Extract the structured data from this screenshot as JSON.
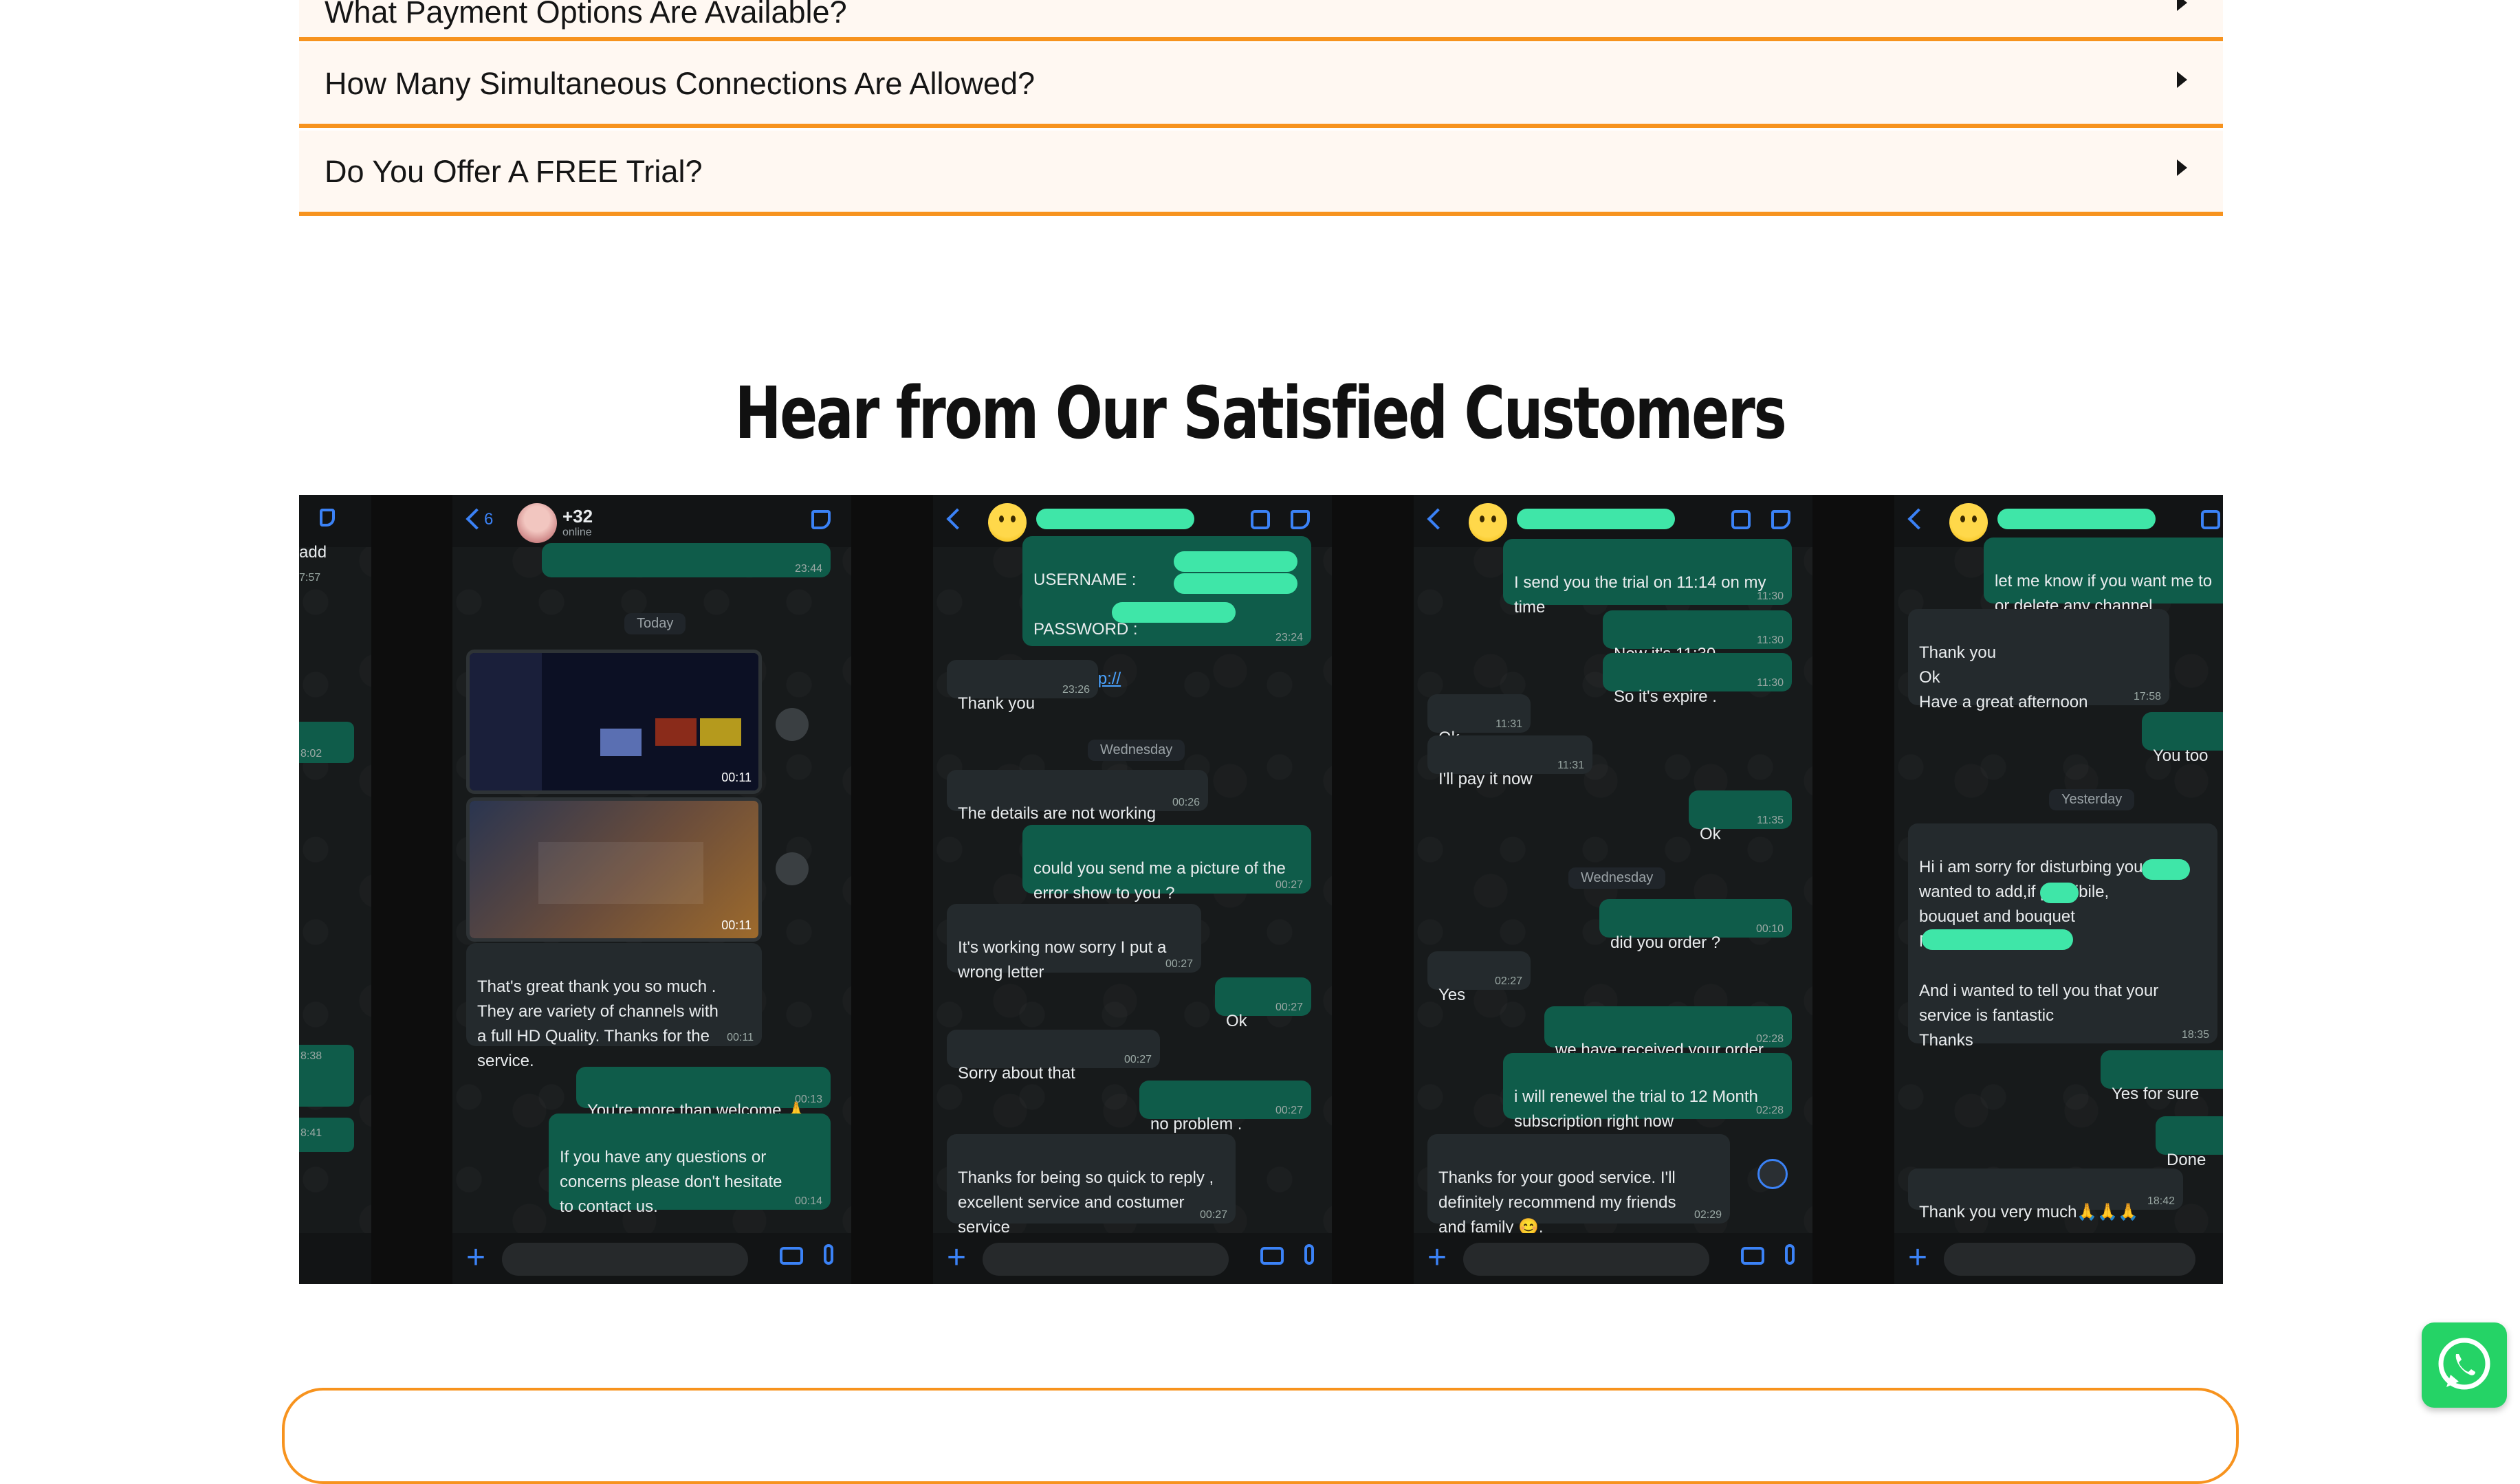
{
  "faq": {
    "items": [
      {
        "question": "What Payment Options Are Available?"
      },
      {
        "question": "How Many Simultaneous Connections Are Allowed?"
      },
      {
        "question": "Do You Offer A FREE Trial?"
      }
    ]
  },
  "testimonials": {
    "title": "Hear from Our Satisfied Customers",
    "screenshots": [
      {
        "header_number": "+32",
        "header_status": "online",
        "day": "Today",
        "messages": [
          {
            "text": "That's great thank you so much .\nThey are variety of channels with\na full HD Quality. Thanks for the\nservice.",
            "time": "00:11",
            "dir": "in"
          },
          {
            "text": "You're more than welcome 🙏",
            "time": "00:13",
            "dir": "out"
          },
          {
            "text": "If you have any questions or\nconcerns please don't hesitate\nto contact us.",
            "time": "00:14",
            "dir": "out"
          }
        ],
        "video_time_1": "00:11",
        "video_time_2": "00:11",
        "top_time": "23:44"
      },
      {
        "credentials": {
          "username": "USERNAME : ",
          "password": "PASSWORD : ",
          "url": "URL : http://"
        },
        "cred_time": "23:24",
        "day": "Wednesday",
        "messages": [
          {
            "text": "Thank you",
            "time": "23:26",
            "dir": "in"
          },
          {
            "text": "The details are not working",
            "time": "00:26",
            "dir": "in"
          },
          {
            "text": "could you send me a picture of the\nerror show to you ?",
            "time": "00:27",
            "dir": "out"
          },
          {
            "text": "It's working now sorry I put a\nwrong letter",
            "time": "00:27",
            "dir": "in"
          },
          {
            "text": "Ok",
            "time": "00:27",
            "dir": "out"
          },
          {
            "text": "Sorry about that",
            "time": "00:27",
            "dir": "in"
          },
          {
            "text": "no problem .",
            "time": "00:27",
            "dir": "out"
          },
          {
            "text": "Thanks for being so quick to reply ,\nexcellent service and costumer\nservice",
            "time": "00:27",
            "dir": "in"
          }
        ]
      },
      {
        "day": "Wednesday",
        "messages": [
          {
            "text": "I send you the trial on 11:14 on my\ntime",
            "time": "11:30",
            "dir": "out"
          },
          {
            "text": "Now it's 11:30",
            "time": "11:30",
            "dir": "out"
          },
          {
            "text": "So it's expire .",
            "time": "11:30",
            "dir": "out"
          },
          {
            "text": "Ok",
            "time": "11:31",
            "dir": "in"
          },
          {
            "text": "I'll pay it now",
            "time": "11:31",
            "dir": "in"
          },
          {
            "text": "Ok",
            "time": "11:35",
            "dir": "out"
          },
          {
            "text": "did you order ?",
            "time": "00:10",
            "dir": "out"
          },
          {
            "text": "Yes",
            "time": "02:27",
            "dir": "in"
          },
          {
            "text": "we have received your order",
            "time": "02:28",
            "dir": "out"
          },
          {
            "text": "i will renewel the trial to 12 Month\nsubscription right now",
            "time": "02:28",
            "dir": "out"
          },
          {
            "text": "Thanks for your good service. I'll\ndefinitely recommend my friends\nand family 😊.",
            "time": "02:29",
            "dir": "in"
          }
        ]
      },
      {
        "day": "Yesterday",
        "messages": [
          {
            "text": "let me know if you want me to\nor delete any channel",
            "time": "",
            "dir": "out"
          },
          {
            "text": "Thank you\nOk\nHave a great afternoon",
            "time": "17:58",
            "dir": "in"
          },
          {
            "text": "You too",
            "time": "",
            "dir": "out"
          },
          {
            "text": "Hi i am sorry for disturbing you,I\nwanted to add,if possibile,\nbouquet and       bouquet\nMy email is\n\nAnd i wanted to tell you that your\nservice is fantastic\nThanks",
            "time": "18:35",
            "dir": "in"
          },
          {
            "text": "Yes for sure",
            "time": "",
            "dir": "out"
          },
          {
            "text": "Done",
            "time": "",
            "dir": "out"
          },
          {
            "text": "Thank you very much🙏🙏🙏",
            "time": "18:42",
            "dir": "in"
          }
        ]
      }
    ]
  },
  "partial_left": {
    "lines": [
      "add",
      "7:57",
      "8:02",
      "8:38",
      "8:41"
    ]
  },
  "colors": {
    "accent": "#f7931e",
    "whatsapp": "#25d366",
    "bubble_out": "#0f5c4a",
    "bubble_in": "#242a2d"
  },
  "icons": {
    "whatsapp": "whatsapp-icon",
    "caret": "caret-right-icon"
  }
}
